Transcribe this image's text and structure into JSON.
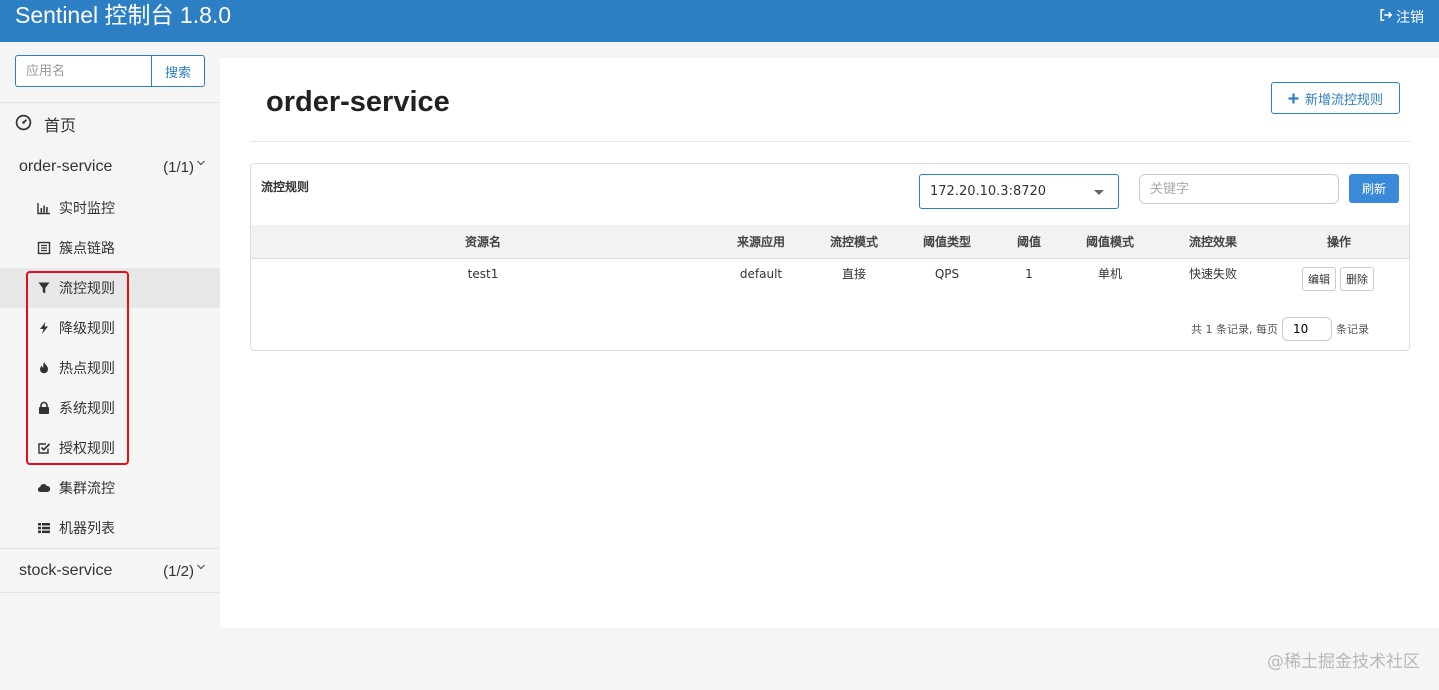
{
  "app": {
    "title": "Sentinel 控制台 1.8.0",
    "logout_label": "注销"
  },
  "sidebar": {
    "search": {
      "placeholder": "应用名",
      "button_label": "搜索"
    },
    "home_label": "首页",
    "apps": [
      {
        "name": "order-service",
        "count": "(1/1)",
        "items": [
          {
            "label": "实时监控",
            "icon": "bar-chart-icon"
          },
          {
            "label": "簇点链路",
            "icon": "list-alt-icon"
          },
          {
            "label": "流控规则",
            "icon": "filter-icon",
            "active": true
          },
          {
            "label": "降级规则",
            "icon": "flash-icon"
          },
          {
            "label": "热点规则",
            "icon": "fire-icon"
          },
          {
            "label": "系统规则",
            "icon": "lock-icon"
          },
          {
            "label": "授权规则",
            "icon": "check-icon"
          },
          {
            "label": "集群流控",
            "icon": "cloud-icon"
          },
          {
            "label": "机器列表",
            "icon": "th-list-icon"
          }
        ]
      },
      {
        "name": "stock-service",
        "count": "(1/2)"
      }
    ]
  },
  "main": {
    "page_title": "order-service",
    "add_button_label": "新增流控规则",
    "panel": {
      "title": "流控规则",
      "machine_select": "172.20.10.3:8720",
      "keyword_placeholder": "关键字",
      "refresh_label": "刷新",
      "columns": [
        "资源名",
        "来源应用",
        "流控模式",
        "阈值类型",
        "阈值",
        "阈值模式",
        "流控效果",
        "操作"
      ],
      "rows": [
        {
          "resource": "test1",
          "limit_app": "default",
          "strategy": "直接",
          "grade": "QPS",
          "count": "1",
          "cluster_mode": "单机",
          "behavior": "快速失败"
        }
      ],
      "actions": {
        "edit": "编辑",
        "delete": "删除"
      },
      "pager": {
        "prefix": "共 1 条记录, 每页",
        "page_size": "10",
        "suffix": "条记录"
      }
    }
  },
  "watermark": "@稀土掘金技术社区",
  "colors": {
    "brand": "#2d7fc4",
    "highlight": "#e0101a"
  }
}
